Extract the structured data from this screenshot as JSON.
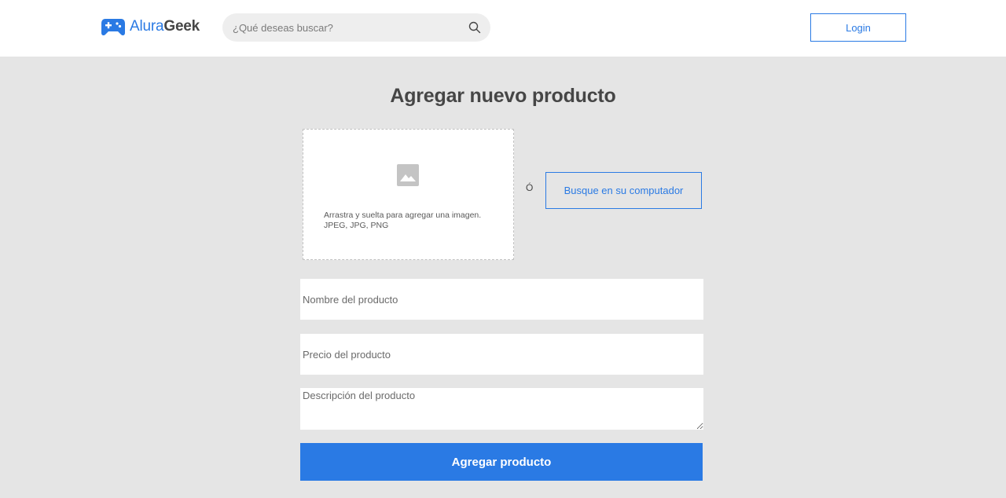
{
  "header": {
    "logo": {
      "part1": "Alura",
      "part2": "Geek",
      "icon": "gamepad-icon"
    },
    "search": {
      "placeholder": "¿Qué deseas buscar?",
      "value": "",
      "icon": "search-icon"
    },
    "login_label": "Login"
  },
  "main": {
    "title": "Agregar nuevo producto",
    "dropzone": {
      "icon": "image-icon",
      "line1": "Arrastra y suelta para agregar una imagen.",
      "line2": "JPEG, JPG, PNG"
    },
    "or_label": "Ó",
    "browse_label": "Busque en su computador",
    "fields": {
      "name_placeholder": "Nombre del producto",
      "price_placeholder": "Precio del producto",
      "description_placeholder": "Descripción del producto"
    },
    "submit_label": "Agregar producto"
  },
  "colors": {
    "accent": "#2a7ae4",
    "text": "#464646",
    "background": "#e5e5e5",
    "surface": "#ffffff"
  }
}
